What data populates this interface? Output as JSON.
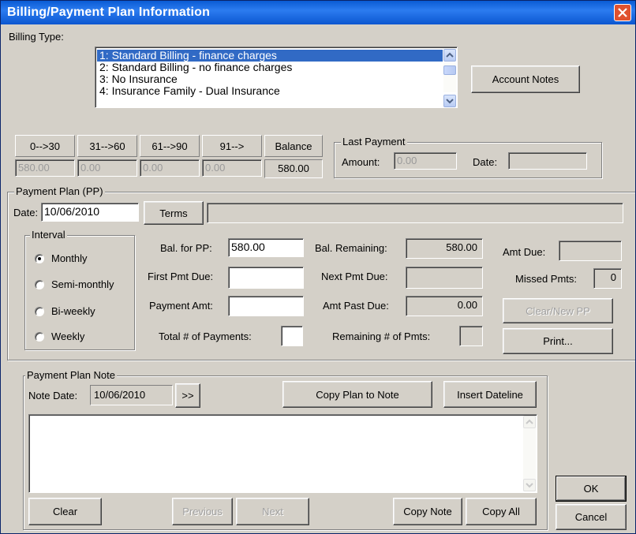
{
  "window": {
    "title": "Billing/Payment Plan Information"
  },
  "billing": {
    "label": "Billing Type:",
    "items": [
      "1: Standard Billing - finance charges",
      "2: Standard Billing - no finance charges",
      "3: No Insurance",
      "4: Insurance Family - Dual Insurance"
    ],
    "selected_index": 0
  },
  "account_notes_label": "Account Notes",
  "aging": {
    "headers": [
      "0-->30",
      "31-->60",
      "61-->90",
      "91-->",
      "Balance"
    ],
    "values": [
      "580.00",
      "0.00",
      "0.00",
      "0.00",
      "580.00"
    ]
  },
  "last_payment": {
    "caption": "Last Payment",
    "amount_label": "Amount:",
    "amount": "0.00",
    "date_label": "Date:",
    "date": ""
  },
  "pp": {
    "caption": "Payment Plan (PP)",
    "date_label": "Date:",
    "date": "10/06/2010",
    "terms_label": "Terms",
    "terms_value": "",
    "interval": {
      "caption": "Interval",
      "options": [
        "Monthly",
        "Semi-monthly",
        "Bi-weekly",
        "Weekly"
      ],
      "selected": "Monthly"
    },
    "bal_for_pp_label": "Bal. for PP:",
    "bal_for_pp": "580.00",
    "first_pmt_due_label": "First Pmt Due:",
    "first_pmt_due": "",
    "payment_amt_label": "Payment Amt:",
    "payment_amt": "",
    "total_payments_label": "Total # of Payments:",
    "total_payments": "",
    "bal_remaining_label": "Bal. Remaining:",
    "bal_remaining": "580.00",
    "next_pmt_due_label": "Next Pmt Due:",
    "next_pmt_due": "",
    "amt_past_due_label": "Amt Past Due:",
    "amt_past_due": "0.00",
    "remaining_pmts_label": "Remaining # of Pmts:",
    "remaining_pmts": "",
    "amt_due_label": "Amt Due:",
    "amt_due": "",
    "missed_pmts_label": "Missed Pmts:",
    "missed_pmts": "0",
    "clear_new_pp_label": "Clear/New PP",
    "print_label": "Print..."
  },
  "note": {
    "caption": "Payment Plan Note",
    "note_date_label": "Note Date:",
    "note_date": "10/06/2010",
    "next_date_label": ">>",
    "copy_plan_label": "Copy Plan to Note",
    "insert_dateline_label": "Insert Dateline",
    "text": "",
    "clear_label": "Clear",
    "previous_label": "Previous",
    "next_label": "Next",
    "copy_note_label": "Copy Note",
    "copy_all_label": "Copy All"
  },
  "ok_label": "OK",
  "cancel_label": "Cancel",
  "colors": {
    "title_bar": "#0a5bd4",
    "selection": "#316ac5",
    "dialog_bg": "#d4d0c8",
    "close_button": "#e0522f"
  },
  "icons": [
    "close-icon",
    "scroll-up-arrow-icon",
    "scroll-down-arrow-icon",
    "radio-button-icon"
  ]
}
